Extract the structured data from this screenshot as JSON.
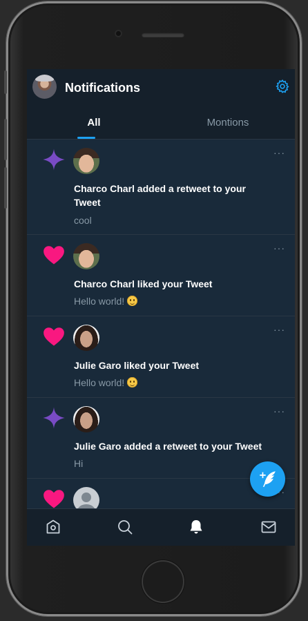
{
  "header": {
    "title": "Notifications",
    "avatar": "user-avatar",
    "settings_icon": "gear-icon"
  },
  "tabs": [
    {
      "label": "All",
      "active": true
    },
    {
      "label": "Montions",
      "active": false
    }
  ],
  "notifications": [
    {
      "type": "retweet",
      "icon": "sparkle-icon",
      "user": "Charco Charl",
      "headline": "Charco Charl added a retweet to your Tweet",
      "snippet": "cool",
      "emoji": false
    },
    {
      "type": "like",
      "icon": "heart-icon",
      "user": "Charco Charl",
      "headline": "Charco Charl liked your Tweet",
      "snippet": "Hello world!",
      "emoji": true
    },
    {
      "type": "like",
      "icon": "heart-icon",
      "user": "Julie Garo",
      "headline": "Julie Garo liked your Tweet",
      "snippet": "Hello world!",
      "emoji": true
    },
    {
      "type": "retweet",
      "icon": "sparkle-icon",
      "user": "Julie Garo",
      "headline": "Julie Garo added a retweet to your Tweet",
      "snippet": "Hi",
      "emoji": false
    },
    {
      "type": "like",
      "icon": "heart-icon",
      "user": "",
      "headline": "",
      "snippet": "",
      "emoji": false
    }
  ],
  "more_label": "···",
  "fab": {
    "icon": "compose-tweet-icon"
  },
  "bottom_nav": [
    {
      "icon": "home-icon"
    },
    {
      "icon": "search-icon"
    },
    {
      "icon": "bell-icon",
      "active": true
    },
    {
      "icon": "mail-icon"
    }
  ],
  "colors": {
    "accent": "#1da1f2",
    "heart": "#f91880",
    "sparkle": "#794bc4",
    "background": "#15202b",
    "card": "#192a3a"
  }
}
